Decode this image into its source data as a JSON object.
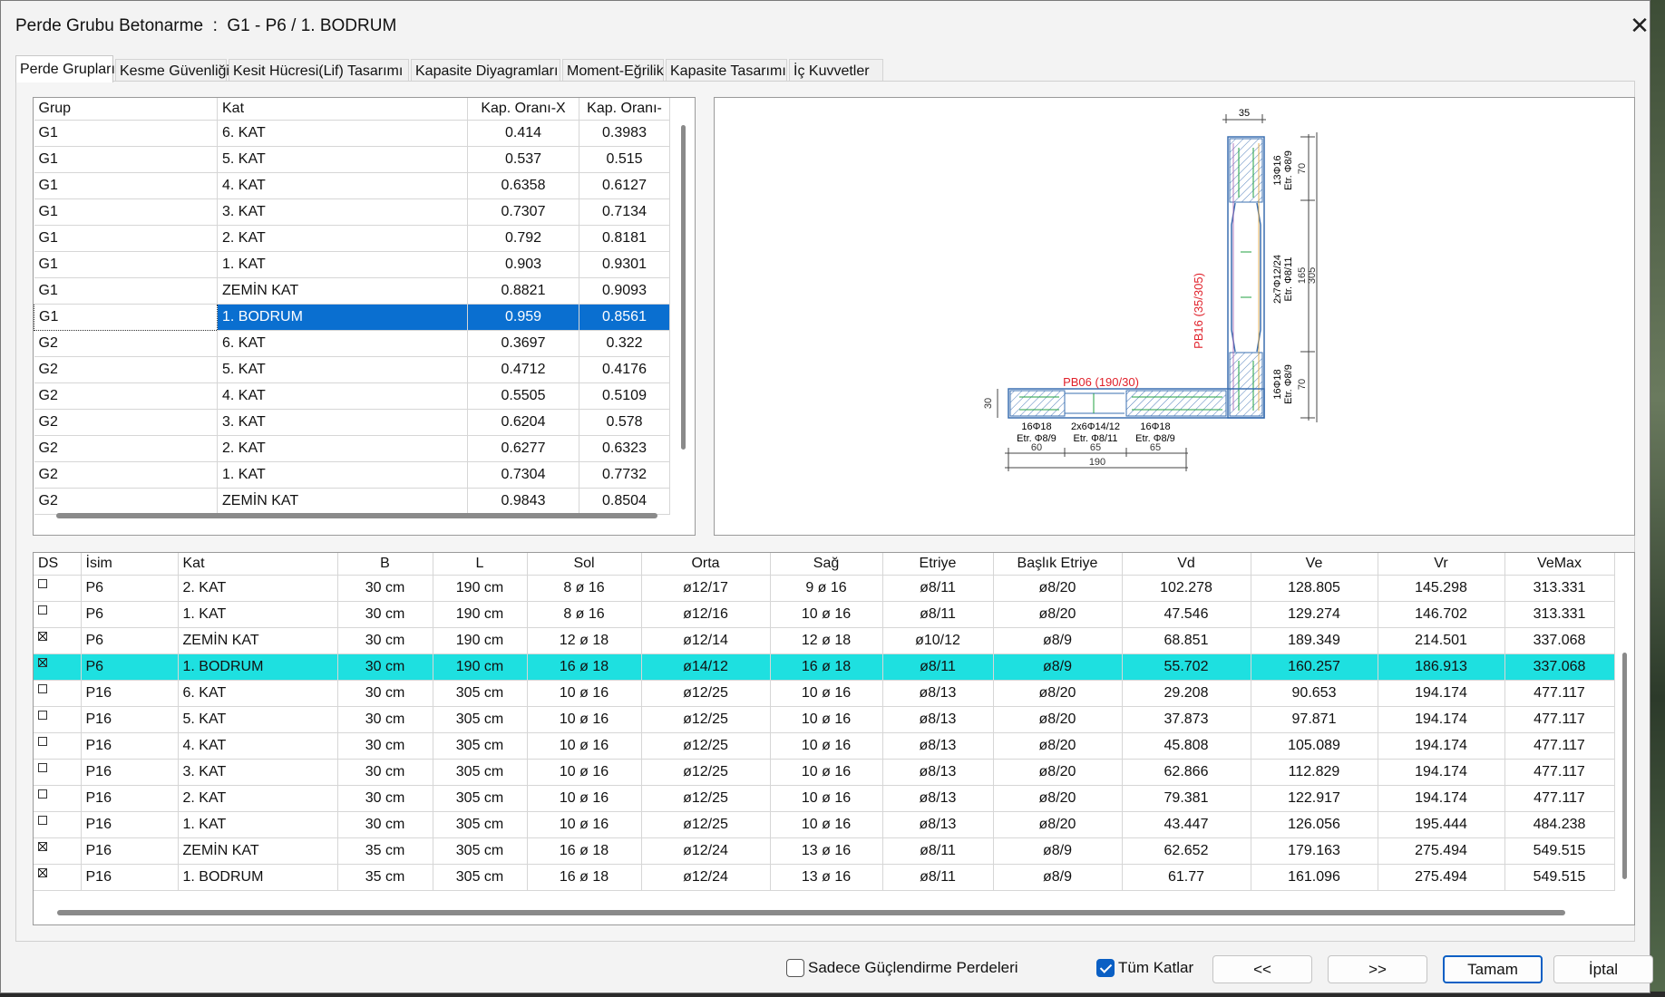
{
  "window": {
    "title": "Perde Grubu Betonarme  :  G1 - P6 / 1. BODRUM"
  },
  "tabs": [
    "Perde Grupları",
    "Kesme Güvenliği",
    "Kesit Hücresi(Lif) Tasarımı",
    "Kapasite Diyagramları",
    "Moment-Eğrilik",
    "Kapasite Tasarımı",
    "İç Kuvvetler"
  ],
  "groups_table": {
    "headers": [
      "Grup",
      "Kat",
      "Kap. Oranı-X",
      "Kap. Oranı-"
    ],
    "rows": [
      [
        "G1",
        "6. KAT",
        "0.414",
        "0.3983"
      ],
      [
        "G1",
        "5. KAT",
        "0.537",
        "0.515"
      ],
      [
        "G1",
        "4. KAT",
        "0.6358",
        "0.6127"
      ],
      [
        "G1",
        "3. KAT",
        "0.7307",
        "0.7134"
      ],
      [
        "G1",
        "2. KAT",
        "0.792",
        "0.8181"
      ],
      [
        "G1",
        "1. KAT",
        "0.903",
        "0.9301"
      ],
      [
        "G1",
        "ZEMİN KAT",
        "0.8821",
        "0.9093"
      ],
      [
        "G1",
        "1. BODRUM",
        "0.959",
        "0.8561"
      ],
      [
        "G2",
        "6. KAT",
        "0.3697",
        "0.322"
      ],
      [
        "G2",
        "5. KAT",
        "0.4712",
        "0.4176"
      ],
      [
        "G2",
        "4. KAT",
        "0.5505",
        "0.5109"
      ],
      [
        "G2",
        "3. KAT",
        "0.6204",
        "0.578"
      ],
      [
        "G2",
        "2. KAT",
        "0.6277",
        "0.6323"
      ],
      [
        "G2",
        "1. KAT",
        "0.7304",
        "0.7732"
      ],
      [
        "G2",
        "ZEMİN KAT",
        "0.9843",
        "0.8504"
      ]
    ],
    "selected_row": 7
  },
  "drawing": {
    "dim_top": "35",
    "dim_vert_top": "70",
    "dim_vert_mid": "165",
    "dim_vert_bot": "70",
    "dim_vert_total": "305",
    "dim_left": "30",
    "dims_bottom": [
      "60",
      "65",
      "65"
    ],
    "dim_bottom_total": "190",
    "label_vertical_wall": "PB16 (35/305)",
    "label_horizontal_wall": "PB06 (190/30)",
    "rebar_top_end": [
      "13Φ16",
      "Etr. Φ8/9"
    ],
    "rebar_mid": [
      "2x7Φ12/24",
      "Etr. Φ8/11"
    ],
    "rebar_bot_end": [
      "16Φ18",
      "Etr. Φ8/9"
    ],
    "rebar_h_left": [
      "16Φ18",
      "Etr. Φ8/9"
    ],
    "rebar_h_mid": [
      "2x6Φ14/12",
      "Etr. Φ8/11"
    ],
    "rebar_h_right": [
      "16Φ18",
      "Etr. Φ8/9"
    ],
    "colors": {
      "label": "#e0202a",
      "hatch": "#3a6fb0",
      "rebar": "#20a040"
    }
  },
  "walls_table": {
    "headers": [
      "DS",
      "İsim",
      "Kat",
      "B",
      "L",
      "Sol",
      "Orta",
      "Sağ",
      "Etriye",
      "Başlık Etriye",
      "Vd",
      "Ve",
      "Vr",
      "VeMax"
    ],
    "rows": [
      {
        "ds": false,
        "cells": [
          "P6",
          "2. KAT",
          "30 cm",
          "190 cm",
          "8 ø 16",
          "ø12/17",
          "9 ø 16",
          "ø8/11",
          "ø8/20",
          "102.278",
          "128.805",
          "145.298",
          "313.331"
        ]
      },
      {
        "ds": false,
        "cells": [
          "P6",
          "1. KAT",
          "30 cm",
          "190 cm",
          "8 ø 16",
          "ø12/16",
          "10 ø 16",
          "ø8/11",
          "ø8/20",
          "47.546",
          "129.274",
          "146.702",
          "313.331"
        ]
      },
      {
        "ds": true,
        "cells": [
          "P6",
          "ZEMİN KAT",
          "30 cm",
          "190 cm",
          "12 ø 18",
          "ø12/14",
          "12 ø 18",
          "ø10/12",
          "ø8/9",
          "68.851",
          "189.349",
          "214.501",
          "337.068"
        ]
      },
      {
        "ds": true,
        "cells": [
          "P6",
          "1. BODRUM",
          "30 cm",
          "190 cm",
          "16 ø 18",
          "ø14/12",
          "16 ø 18",
          "ø8/11",
          "ø8/9",
          "55.702",
          "160.257",
          "186.913",
          "337.068"
        ]
      },
      {
        "ds": false,
        "cells": [
          "P16",
          "6. KAT",
          "30 cm",
          "305 cm",
          "10 ø 16",
          "ø12/25",
          "10 ø 16",
          "ø8/13",
          "ø8/20",
          "29.208",
          "90.653",
          "194.174",
          "477.117"
        ]
      },
      {
        "ds": false,
        "cells": [
          "P16",
          "5. KAT",
          "30 cm",
          "305 cm",
          "10 ø 16",
          "ø12/25",
          "10 ø 16",
          "ø8/13",
          "ø8/20",
          "37.873",
          "97.871",
          "194.174",
          "477.117"
        ]
      },
      {
        "ds": false,
        "cells": [
          "P16",
          "4. KAT",
          "30 cm",
          "305 cm",
          "10 ø 16",
          "ø12/25",
          "10 ø 16",
          "ø8/13",
          "ø8/20",
          "45.808",
          "105.089",
          "194.174",
          "477.117"
        ]
      },
      {
        "ds": false,
        "cells": [
          "P16",
          "3. KAT",
          "30 cm",
          "305 cm",
          "10 ø 16",
          "ø12/25",
          "10 ø 16",
          "ø8/13",
          "ø8/20",
          "62.866",
          "112.829",
          "194.174",
          "477.117"
        ]
      },
      {
        "ds": false,
        "cells": [
          "P16",
          "2. KAT",
          "30 cm",
          "305 cm",
          "10 ø 16",
          "ø12/25",
          "10 ø 16",
          "ø8/13",
          "ø8/20",
          "79.381",
          "122.917",
          "194.174",
          "477.117"
        ]
      },
      {
        "ds": false,
        "cells": [
          "P16",
          "1. KAT",
          "30 cm",
          "305 cm",
          "10 ø 16",
          "ø12/25",
          "10 ø 16",
          "ø8/13",
          "ø8/20",
          "43.447",
          "126.056",
          "195.444",
          "484.238"
        ]
      },
      {
        "ds": true,
        "cells": [
          "P16",
          "ZEMİN KAT",
          "35 cm",
          "305 cm",
          "16 ø 18",
          "ø12/24",
          "13 ø 16",
          "ø8/11",
          "ø8/9",
          "62.652",
          "179.163",
          "275.494",
          "549.515"
        ]
      },
      {
        "ds": true,
        "cells": [
          "P16",
          "1. BODRUM",
          "35 cm",
          "305 cm",
          "16 ø 18",
          "ø12/24",
          "13 ø 16",
          "ø8/11",
          "ø8/9",
          "61.77",
          "161.096",
          "275.494",
          "549.515"
        ]
      }
    ],
    "selected_row": 3
  },
  "footer": {
    "only_strengthening_label": "Sadece Güçlendirme Perdeleri",
    "only_strengthening_checked": false,
    "all_floors_label": "Tüm Katlar",
    "all_floors_checked": true,
    "prev_label": "<<",
    "next_label": ">>",
    "ok_label": "Tamam",
    "cancel_label": "İptal"
  }
}
